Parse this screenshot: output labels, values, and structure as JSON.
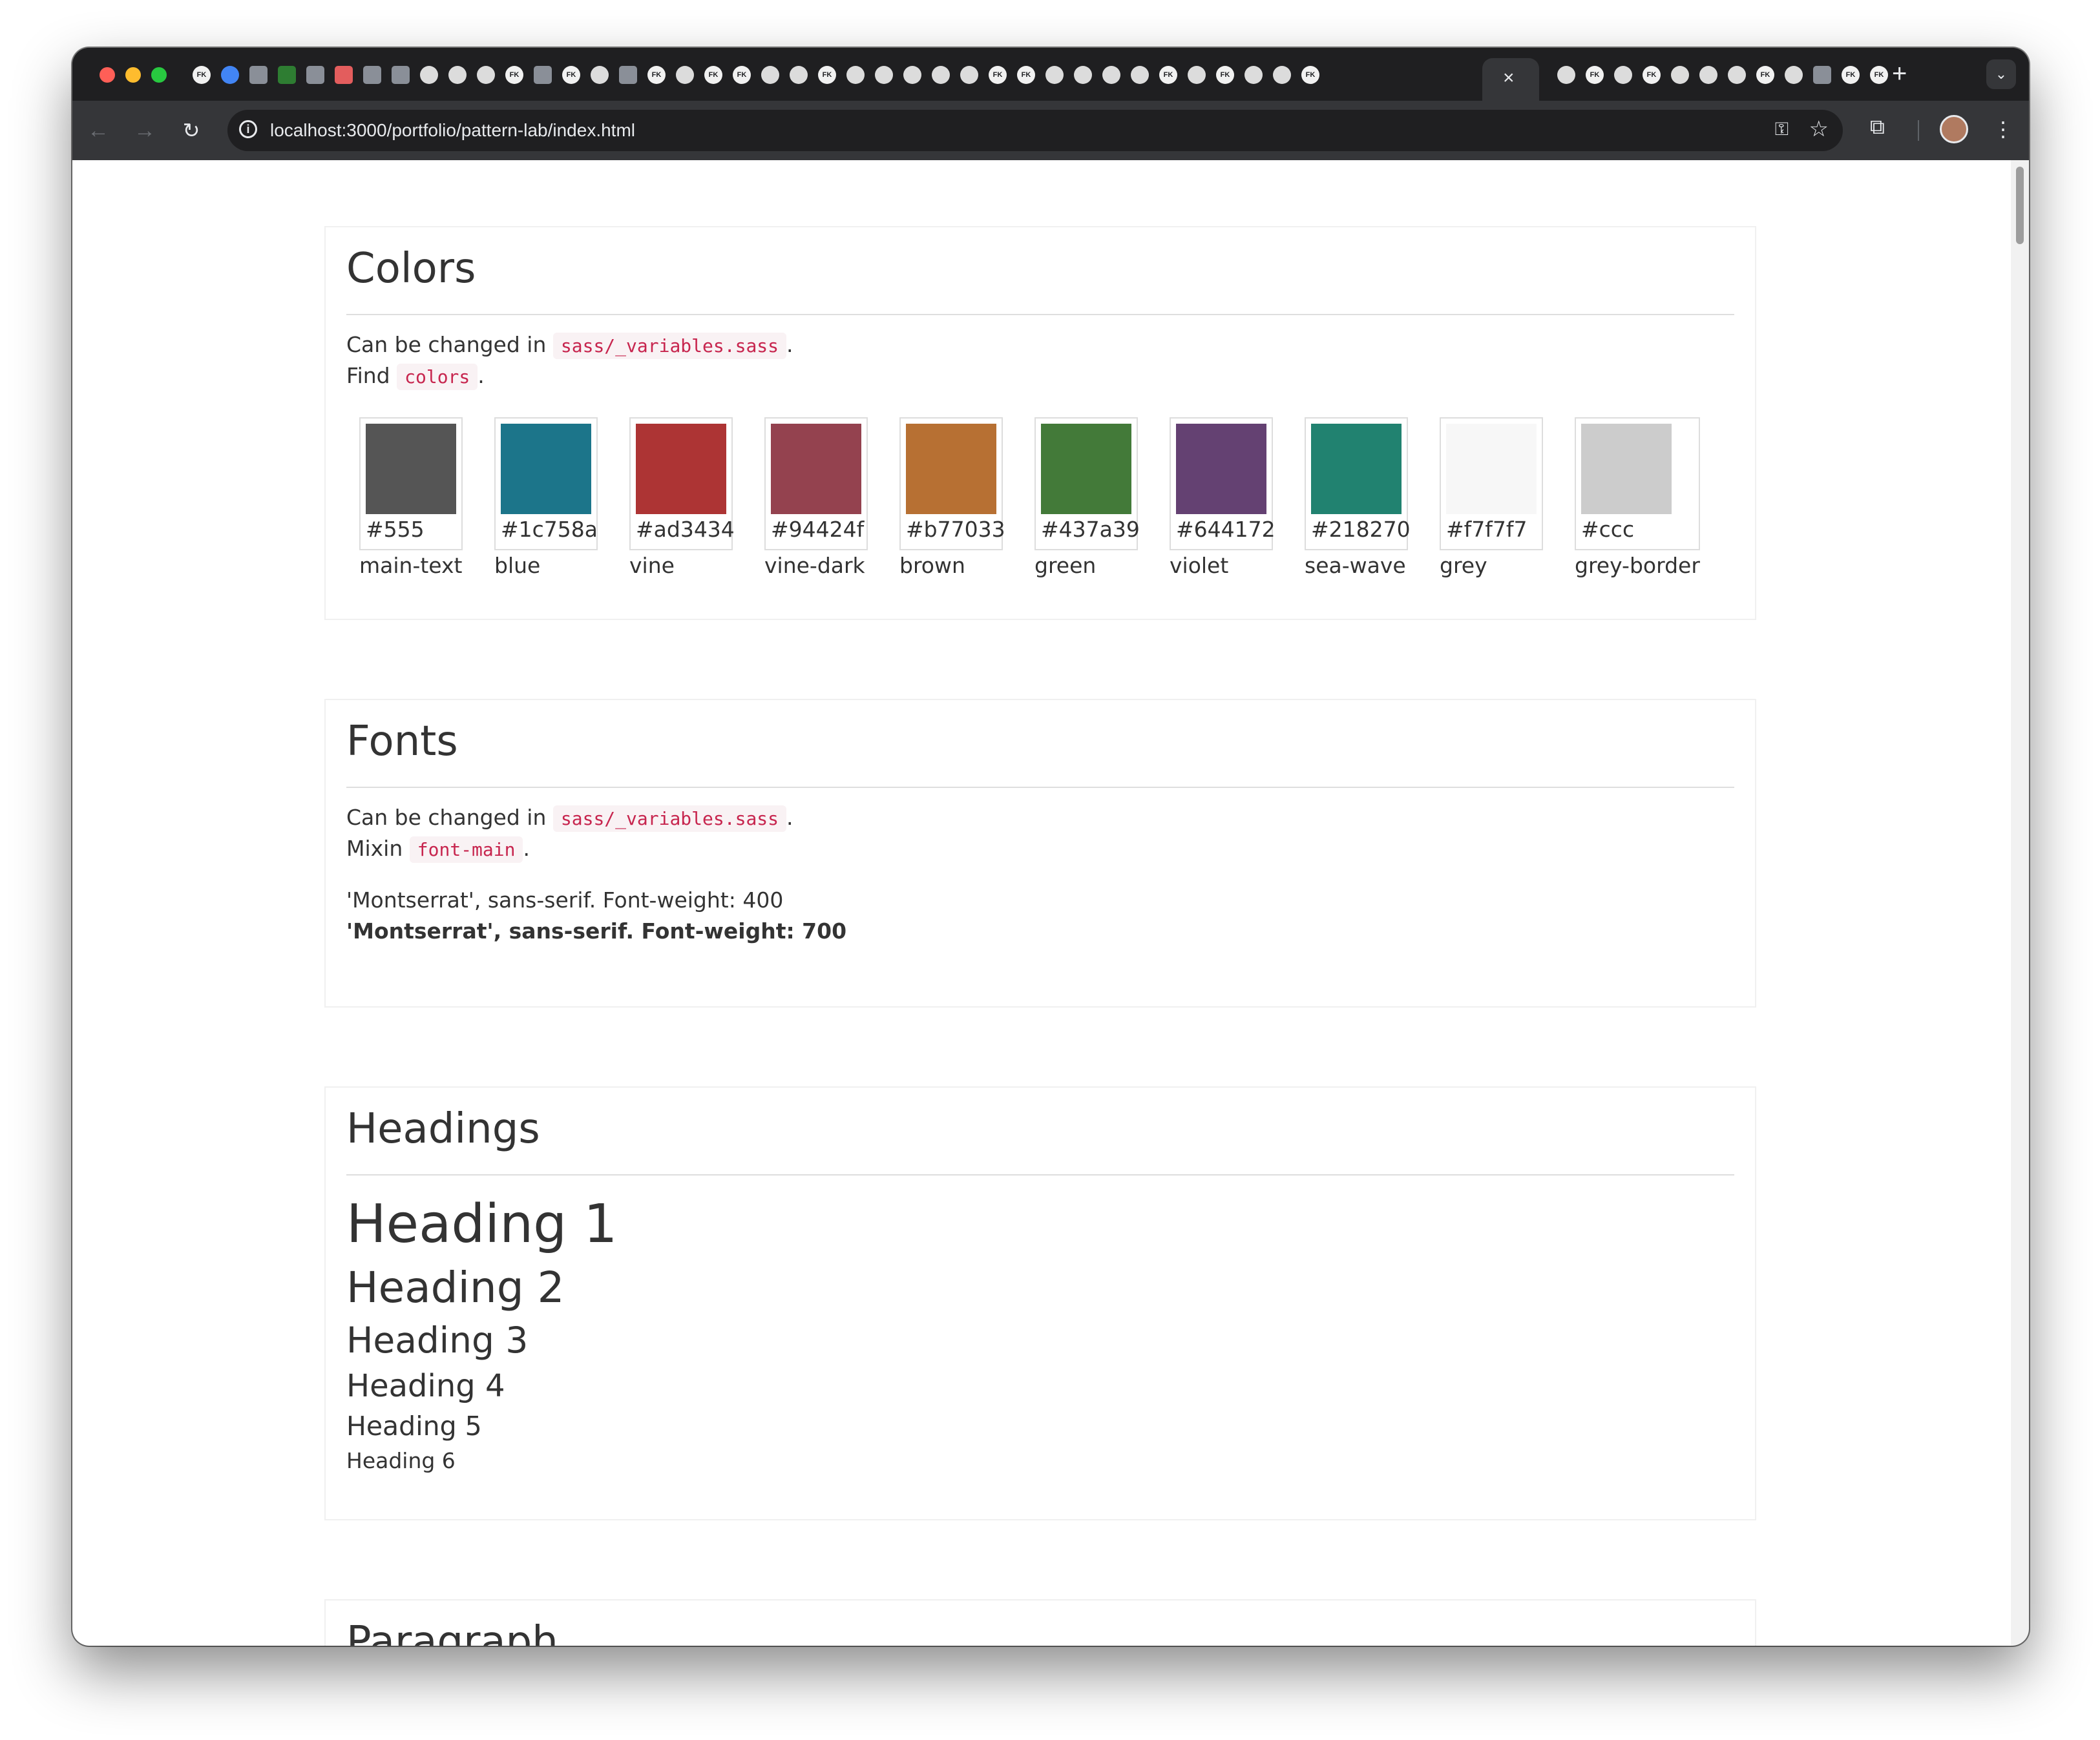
{
  "browser": {
    "url": "localhost:3000/portfolio/pattern-lab/index.html",
    "active_tab_close": "×",
    "new_tab": "+",
    "tabs": [
      {
        "icon": "fk-icon",
        "text": "FK"
      },
      {
        "icon": "chrome-icon",
        "text": ""
      },
      {
        "icon": "app-icon",
        "text": ""
      },
      {
        "icon": "chart-icon",
        "text": ""
      },
      {
        "icon": "app-icon",
        "text": ""
      },
      {
        "icon": "cloud-icon",
        "text": ""
      },
      {
        "icon": "app-icon",
        "text": ""
      },
      {
        "icon": "app-icon",
        "text": ""
      },
      {
        "icon": "globe-icon",
        "text": ""
      },
      {
        "icon": "globe-icon",
        "text": ""
      },
      {
        "icon": "globe-icon",
        "text": ""
      },
      {
        "icon": "fk-icon",
        "text": "FK"
      },
      {
        "icon": "app-icon",
        "text": ""
      },
      {
        "icon": "fk-icon",
        "text": "FK"
      },
      {
        "icon": "globe-icon",
        "text": ""
      },
      {
        "icon": "app-icon",
        "text": ""
      },
      {
        "icon": "fk-icon",
        "text": "FK"
      },
      {
        "icon": "globe-icon",
        "text": ""
      },
      {
        "icon": "fk-icon",
        "text": "FK"
      },
      {
        "icon": "fk-icon",
        "text": "FK"
      },
      {
        "icon": "globe-icon",
        "text": ""
      },
      {
        "icon": "globe-icon",
        "text": ""
      },
      {
        "icon": "fk-icon",
        "text": "FK"
      },
      {
        "icon": "globe-icon",
        "text": ""
      },
      {
        "icon": "globe-icon",
        "text": ""
      },
      {
        "icon": "globe-icon",
        "text": ""
      },
      {
        "icon": "globe-icon",
        "text": ""
      },
      {
        "icon": "globe-icon",
        "text": ""
      },
      {
        "icon": "fk-icon",
        "text": "FK"
      },
      {
        "icon": "fk-icon",
        "text": "FK"
      },
      {
        "icon": "globe-icon",
        "text": ""
      },
      {
        "icon": "globe-icon",
        "text": ""
      },
      {
        "icon": "globe-icon",
        "text": ""
      },
      {
        "icon": "globe-icon",
        "text": ""
      },
      {
        "icon": "fk-icon",
        "text": "FK"
      },
      {
        "icon": "globe-icon",
        "text": ""
      },
      {
        "icon": "fk-icon",
        "text": "FK"
      },
      {
        "icon": "globe-icon",
        "text": ""
      },
      {
        "icon": "globe-icon",
        "text": ""
      },
      {
        "icon": "fk-icon",
        "text": "FK"
      }
    ],
    "tabs_after": [
      {
        "icon": "globe-icon",
        "text": ""
      },
      {
        "icon": "fk-icon",
        "text": "FK"
      },
      {
        "icon": "globe-icon",
        "text": ""
      },
      {
        "icon": "fk-icon",
        "text": "FK"
      },
      {
        "icon": "globe-icon",
        "text": ""
      },
      {
        "icon": "globe-icon",
        "text": ""
      },
      {
        "icon": "globe-icon",
        "text": ""
      },
      {
        "icon": "fk-icon",
        "text": "FK"
      },
      {
        "icon": "globe-icon",
        "text": ""
      },
      {
        "icon": "app-icon",
        "text": ""
      },
      {
        "icon": "fk-icon",
        "text": "FK"
      },
      {
        "icon": "fk-icon",
        "text": "FK"
      }
    ]
  },
  "colors": {
    "title": "Colors",
    "line1_pre": "Can be changed in",
    "line1_code": "sass/_variables.sass",
    "line1_post": ".",
    "line2_pre": "Find",
    "line2_code": "colors",
    "line2_post": ".",
    "swatches": [
      {
        "hex": "#555",
        "name": "main-text",
        "color": "#555555"
      },
      {
        "hex": "#1c758a",
        "name": "blue",
        "color": "#1c758a"
      },
      {
        "hex": "#ad3434",
        "name": "vine",
        "color": "#ad3434"
      },
      {
        "hex": "#94424f",
        "name": "vine-dark",
        "color": "#94424f"
      },
      {
        "hex": "#b77033",
        "name": "brown",
        "color": "#b77033"
      },
      {
        "hex": "#437a39",
        "name": "green",
        "color": "#437a39"
      },
      {
        "hex": "#644172",
        "name": "violet",
        "color": "#644172"
      },
      {
        "hex": "#218270",
        "name": "sea-wave",
        "color": "#218270"
      },
      {
        "hex": "#f7f7f7",
        "name": "grey",
        "color": "#f7f7f7"
      },
      {
        "hex": "#ccc",
        "name": "grey-border",
        "color": "#cccccc"
      }
    ]
  },
  "fonts": {
    "title": "Fonts",
    "line1_pre": "Can be changed in",
    "line1_code": "sass/_variables.sass",
    "line1_post": ".",
    "line2_pre": "Mixin",
    "line2_code": "font-main",
    "line2_post": ".",
    "sample_regular": "'Montserrat', sans-serif. Font-weight: 400",
    "sample_bold": "'Montserrat', sans-serif. Font-weight: 700"
  },
  "headings": {
    "title": "Headings",
    "h1": "Heading 1",
    "h2": "Heading 2",
    "h3": "Heading 3",
    "h4": "Heading 4",
    "h5": "Heading 5",
    "h6": "Heading 6"
  },
  "paragraph": {
    "title": "Paragraph"
  }
}
